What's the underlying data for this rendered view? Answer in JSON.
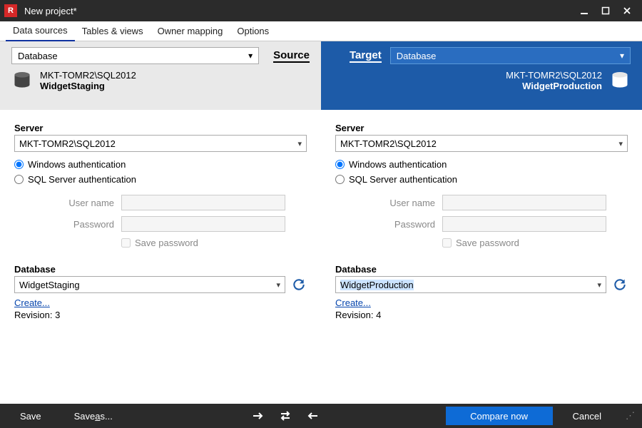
{
  "window": {
    "title": "New project*",
    "app_icon_text": "R"
  },
  "tabs": {
    "data_sources": "Data sources",
    "tables_views": "Tables & views",
    "owner_mapping": "Owner mapping",
    "options": "Options"
  },
  "headers": {
    "source_label": "Source",
    "target_label": "Target",
    "source_dropdown": "Database",
    "target_dropdown": "Database"
  },
  "source": {
    "server_label": "Server",
    "server_value": "MKT-TOMR2\\SQL2012",
    "auth_windows": "Windows authentication",
    "auth_sql": "SQL Server authentication",
    "auth_selected": "windows",
    "user_label": "User name",
    "user_value": "",
    "pass_label": "Password",
    "pass_value": "",
    "save_pass": "Save password",
    "database_label": "Database",
    "database_value": "WidgetStaging",
    "create_link": "Create...",
    "revision_label": "Revision: 3"
  },
  "target": {
    "server_label": "Server",
    "server_value": "MKT-TOMR2\\SQL2012",
    "auth_windows": "Windows authentication",
    "auth_sql": "SQL Server authentication",
    "auth_selected": "windows",
    "user_label": "User name",
    "user_value": "",
    "pass_label": "Password",
    "pass_value": "",
    "save_pass": "Save password",
    "database_label": "Database",
    "database_value": "WidgetProduction",
    "create_link": "Create...",
    "revision_label": "Revision: 4"
  },
  "summary": {
    "source_server": "MKT-TOMR2\\SQL2012",
    "source_db": "WidgetStaging",
    "target_server": "MKT-TOMR2\\SQL2012",
    "target_db": "WidgetProduction"
  },
  "footer": {
    "save": "Save",
    "save_as_pre": "Save ",
    "save_as_u": "a",
    "save_as_post": "s...",
    "compare": "Compare now",
    "cancel": "Cancel"
  }
}
